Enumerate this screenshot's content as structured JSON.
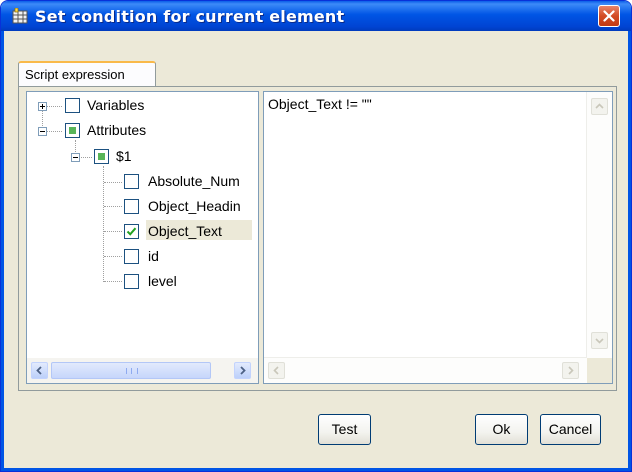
{
  "window": {
    "title": "Set condition for current element",
    "icon": "tree-table-icon"
  },
  "tabs": [
    {
      "label": "Script expression",
      "selected": true
    }
  ],
  "tree": {
    "nodes": [
      {
        "label": "Variables",
        "expander": "plus",
        "check": "unchecked"
      },
      {
        "label": "Attributes",
        "expander": "minus",
        "check": "partial"
      },
      {
        "label": "$1",
        "expander": "minus",
        "check": "partial"
      },
      {
        "label": "Absolute_Num",
        "check": "unchecked"
      },
      {
        "label": "Object_Headin",
        "check": "unchecked"
      },
      {
        "label": "Object_Text",
        "check": "checked",
        "selected": true
      },
      {
        "label": "id",
        "check": "unchecked"
      },
      {
        "label": "level",
        "check": "unchecked"
      }
    ],
    "hscroll_grip": "III"
  },
  "expression": {
    "text": "Object_Text != \"\""
  },
  "buttons": {
    "test": "Test",
    "ok": "Ok",
    "cancel": "Cancel"
  },
  "colors": {
    "titlebar": "#0055e5",
    "close": "#d34a22",
    "check_green": "#21a121",
    "partial_green": "#58b558"
  }
}
